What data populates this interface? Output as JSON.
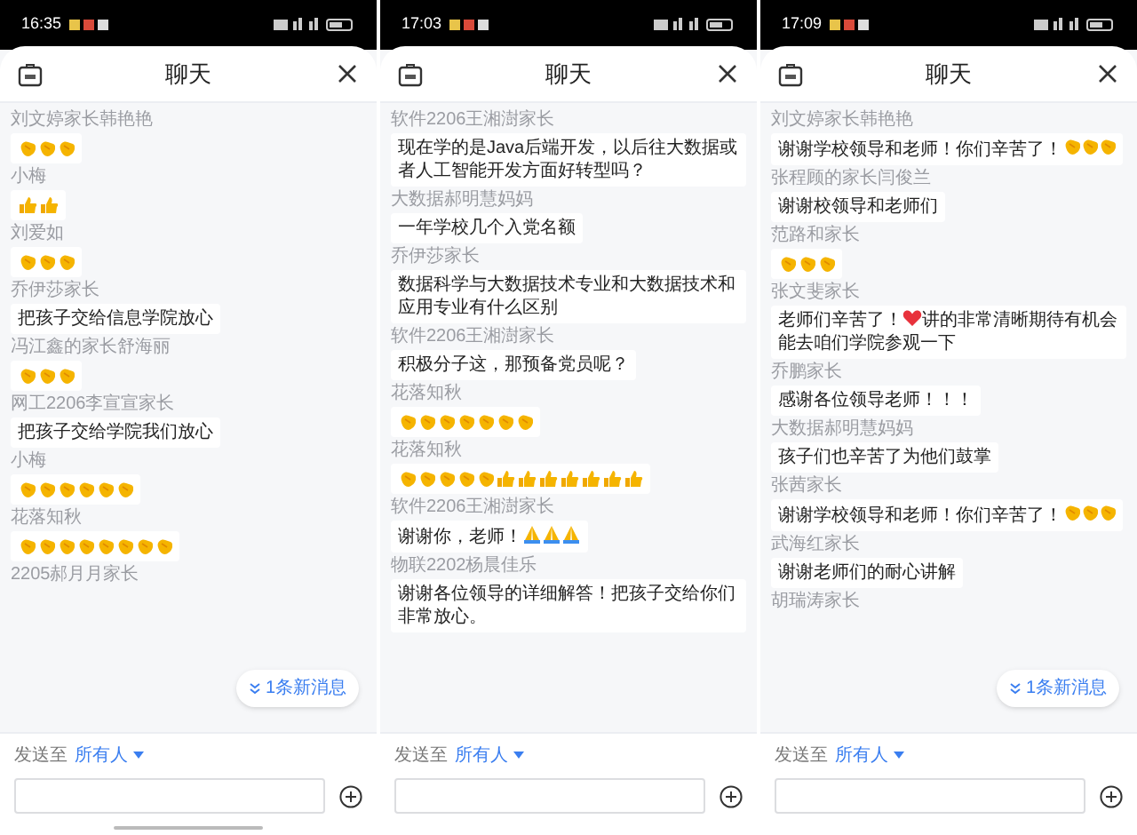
{
  "panels": [
    {
      "status_bar": {
        "time": "16:35"
      },
      "header": {
        "title": "聊天"
      },
      "home_indicator": true,
      "messages": [
        {
          "sender": "刘文婷家长韩艳艳",
          "parts": [
            {
              "kind": "clap"
            },
            {
              "kind": "clap"
            },
            {
              "kind": "clap"
            }
          ]
        },
        {
          "sender": "小梅",
          "parts": [
            {
              "kind": "thumb"
            },
            {
              "kind": "thumb"
            }
          ]
        },
        {
          "sender": "刘爱如",
          "parts": [
            {
              "kind": "clap"
            },
            {
              "kind": "clap"
            },
            {
              "kind": "clap"
            }
          ]
        },
        {
          "sender": "乔伊莎家长",
          "parts": [
            {
              "kind": "text",
              "text": "把孩子交给信息学院放心"
            }
          ]
        },
        {
          "sender": "冯江鑫的家长舒海丽",
          "parts": [
            {
              "kind": "clap"
            },
            {
              "kind": "clap"
            },
            {
              "kind": "clap"
            }
          ]
        },
        {
          "sender": "网工2206李宣宣家长",
          "parts": [
            {
              "kind": "text",
              "text": "把孩子交给学院我们放心"
            }
          ]
        },
        {
          "sender": "小梅",
          "parts": [
            {
              "kind": "clap"
            },
            {
              "kind": "clap"
            },
            {
              "kind": "clap"
            },
            {
              "kind": "clap"
            },
            {
              "kind": "clap"
            },
            {
              "kind": "clap"
            }
          ]
        },
        {
          "sender": "花落知秋",
          "parts": [
            {
              "kind": "clap"
            },
            {
              "kind": "clap"
            },
            {
              "kind": "clap"
            },
            {
              "kind": "clap"
            },
            {
              "kind": "clap"
            },
            {
              "kind": "clap"
            },
            {
              "kind": "clap"
            },
            {
              "kind": "clap"
            }
          ]
        },
        {
          "sender": "2205郝月月家长"
        }
      ],
      "new_messages": {
        "text": "1条新消息"
      },
      "composer": {
        "send_to_label": "发送至",
        "recipient": "所有人"
      }
    },
    {
      "status_bar": {
        "time": "17:03"
      },
      "header": {
        "title": "聊天"
      },
      "home_indicator": false,
      "messages": [
        {
          "sender": "软件2206王湘澍家长",
          "parts": [
            {
              "kind": "text",
              "text": "现在学的是Java后端开发，以后往大数据或者人工智能开发方面好转型吗？"
            }
          ]
        },
        {
          "sender": "大数据郝明慧妈妈",
          "parts": [
            {
              "kind": "text",
              "text": "一年学校几个入党名额"
            }
          ]
        },
        {
          "sender": "乔伊莎家长",
          "parts": [
            {
              "kind": "text",
              "text": "数据科学与大数据技术专业和大数据技术和应用专业有什么区别"
            }
          ]
        },
        {
          "sender": "软件2206王湘澍家长",
          "parts": [
            {
              "kind": "text",
              "text": "积极分子这，那预备党员呢？"
            }
          ]
        },
        {
          "sender": "花落知秋",
          "parts": [
            {
              "kind": "clap"
            },
            {
              "kind": "clap"
            },
            {
              "kind": "clap"
            },
            {
              "kind": "clap"
            },
            {
              "kind": "clap"
            },
            {
              "kind": "clap"
            },
            {
              "kind": "clap"
            }
          ]
        },
        {
          "sender": "花落知秋",
          "parts": [
            {
              "kind": "clap"
            },
            {
              "kind": "clap"
            },
            {
              "kind": "clap"
            },
            {
              "kind": "clap"
            },
            {
              "kind": "clap"
            },
            {
              "kind": "thumb"
            },
            {
              "kind": "thumb"
            },
            {
              "kind": "thumb"
            },
            {
              "kind": "thumb"
            },
            {
              "kind": "thumb"
            },
            {
              "kind": "thumb"
            },
            {
              "kind": "thumb"
            }
          ]
        },
        {
          "sender": "软件2206王湘澍家长",
          "parts": [
            {
              "kind": "text",
              "text": "谢谢你，老师！"
            },
            {
              "kind": "pray"
            },
            {
              "kind": "pray"
            },
            {
              "kind": "pray"
            }
          ]
        },
        {
          "sender": "物联2202杨晨佳乐",
          "parts": [
            {
              "kind": "text",
              "text": "谢谢各位领导的详细解答！把孩子交给你们非常放心。"
            }
          ]
        }
      ],
      "composer": {
        "send_to_label": "发送至",
        "recipient": "所有人"
      }
    },
    {
      "status_bar": {
        "time": "17:09"
      },
      "header": {
        "title": "聊天"
      },
      "home_indicator": false,
      "messages": [
        {
          "sender": "刘文婷家长韩艳艳",
          "parts": [
            {
              "kind": "text",
              "text": "谢谢学校领导和老师！你们辛苦了！"
            },
            {
              "kind": "clap"
            },
            {
              "kind": "clap"
            },
            {
              "kind": "clap"
            }
          ]
        },
        {
          "sender": "张程顾的家长闫俊兰",
          "parts": [
            {
              "kind": "text",
              "text": "谢谢校领导和老师们"
            }
          ]
        },
        {
          "sender": "范路和家长",
          "parts": [
            {
              "kind": "clap"
            },
            {
              "kind": "clap"
            },
            {
              "kind": "clap"
            }
          ]
        },
        {
          "sender": "张文斐家长",
          "parts": [
            {
              "kind": "text",
              "text": "老师们辛苦了！"
            },
            {
              "kind": "heart"
            },
            {
              "kind": "text",
              "text": "讲的非常清晰期待有机会能去咱们学院参观一下"
            }
          ]
        },
        {
          "sender": "乔鹏家长",
          "parts": [
            {
              "kind": "text",
              "text": "感谢各位领导老师！！！"
            }
          ]
        },
        {
          "sender": "大数据郝明慧妈妈",
          "parts": [
            {
              "kind": "text",
              "text": "孩子们也辛苦了为他们鼓掌"
            }
          ]
        },
        {
          "sender": "张茜家长",
          "parts": [
            {
              "kind": "text",
              "text": "谢谢学校领导和老师！你们辛苦了！"
            },
            {
              "kind": "clap"
            },
            {
              "kind": "clap"
            },
            {
              "kind": "clap"
            }
          ]
        },
        {
          "sender": "武海红家长",
          "parts": [
            {
              "kind": "text",
              "text": "谢谢老师们的耐心讲解"
            }
          ]
        },
        {
          "sender": "胡瑞涛家长"
        }
      ],
      "new_messages": {
        "text": "1条新消息"
      },
      "composer": {
        "send_to_label": "发送至",
        "recipient": "所有人"
      }
    }
  ]
}
